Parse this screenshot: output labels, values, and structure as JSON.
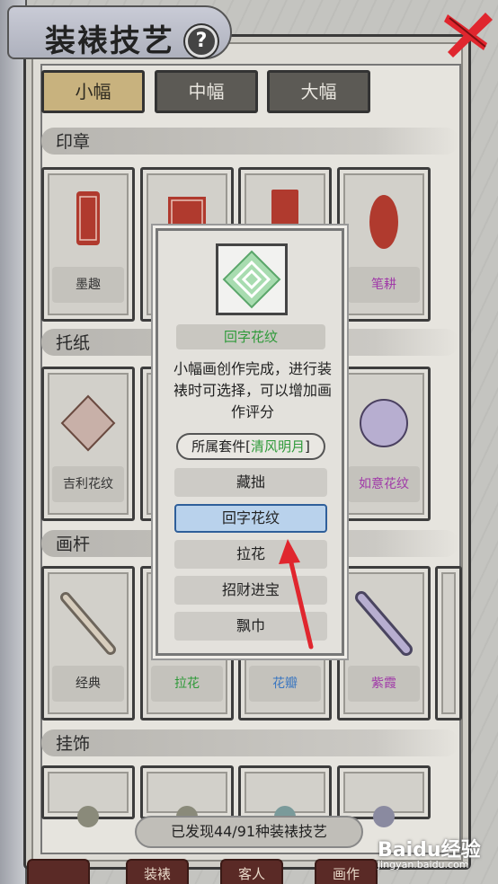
{
  "header": {
    "title": "装裱技艺",
    "help_label": "?"
  },
  "size_tabs": [
    {
      "label": "小幅",
      "active": true
    },
    {
      "label": "中幅",
      "active": false
    },
    {
      "label": "大幅",
      "active": false
    }
  ],
  "sections": [
    {
      "label": "印章"
    },
    {
      "label": "托纸"
    },
    {
      "label": "画杆"
    },
    {
      "label": "挂饰"
    }
  ],
  "seal_cards": [
    {
      "label": "墨趣"
    },
    {
      "label": ""
    },
    {
      "label": ""
    },
    {
      "label": "笔耕"
    }
  ],
  "paper_cards": [
    {
      "label": "吉利花纹"
    },
    {
      "label": ""
    },
    {
      "label": ""
    },
    {
      "label": "如意花纹"
    }
  ],
  "rod_cards": [
    {
      "label": "经典"
    },
    {
      "label": "拉花"
    },
    {
      "label": "花瓣"
    },
    {
      "label": "紫霞"
    }
  ],
  "popup": {
    "name": "回字花纹",
    "desc": "小幅画创作完成，进行装裱时可选择，可以增加画作评分",
    "set_prefix": "所属套件[",
    "set_name": "清风明月",
    "set_suffix": "]",
    "options": [
      {
        "label": "藏拙",
        "selected": false
      },
      {
        "label": "回字花纹",
        "selected": true
      },
      {
        "label": "拉花",
        "selected": false
      },
      {
        "label": "招财进宝",
        "selected": false
      },
      {
        "label": "飘巾",
        "selected": false
      }
    ]
  },
  "footer": {
    "discover_text": "已发现44/91种装裱技艺"
  },
  "bottom_tabs": [
    "",
    "装裱",
    "客人",
    "画作"
  ],
  "watermark": {
    "main": "Baidu经验",
    "sub": "jingyan.baidu.com"
  },
  "colors": {
    "green": "#2f9a3a",
    "purple": "#a03aa8",
    "blue": "#3a76c0",
    "accent_red": "#e0262e"
  }
}
